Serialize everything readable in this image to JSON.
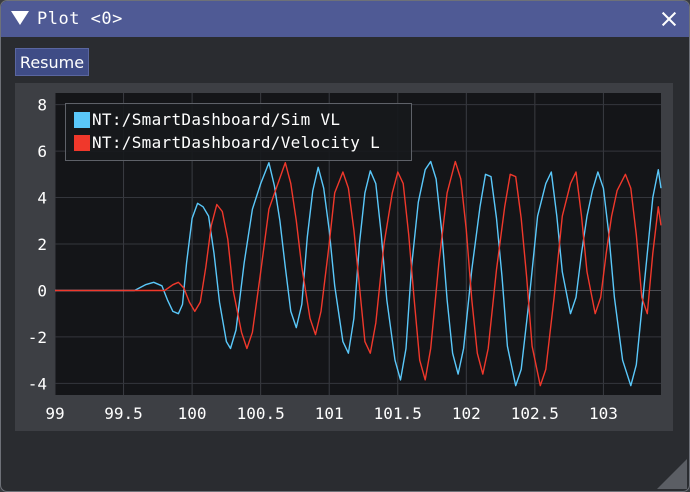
{
  "window": {
    "title": "Plot <0>"
  },
  "toolbar": {
    "resume_label": "Resume"
  },
  "colors": {
    "title_bar": "#4f5a95",
    "window_bg": "#2a2c30",
    "plot_bg": "#141518",
    "series_sim_vl": "#5ac8fa",
    "series_velocity_l": "#f0382b"
  },
  "icons": {
    "collapse": "triangle-down-icon",
    "close": "close-icon",
    "resize": "resize-grip-icon"
  },
  "chart_data": {
    "type": "line",
    "title": "",
    "xlabel": "",
    "ylabel": "",
    "xlim": [
      99,
      103.42
    ],
    "ylim": [
      -4.5,
      8.5
    ],
    "xticks": [
      "99",
      "99.5",
      "100",
      "100.5",
      "101",
      "101.5",
      "102",
      "102.5",
      "103"
    ],
    "yticks": [
      "8",
      "6",
      "4",
      "2",
      "0",
      "-2",
      "-4"
    ],
    "grid": true,
    "legend_placement": "top-left",
    "series": [
      {
        "name": "NT:/SmartDashboard/Sim VL",
        "color": "#5ac8fa",
        "points": [
          [
            99.0,
            0
          ],
          [
            99.58,
            0
          ],
          [
            99.66,
            0.25
          ],
          [
            99.72,
            0.35
          ],
          [
            99.78,
            0.2
          ],
          [
            99.82,
            -0.4
          ],
          [
            99.86,
            -0.9
          ],
          [
            99.9,
            -1.0
          ],
          [
            99.93,
            -0.6
          ],
          [
            99.96,
            1.2
          ],
          [
            100.0,
            3.1
          ],
          [
            100.04,
            3.75
          ],
          [
            100.08,
            3.6
          ],
          [
            100.12,
            3.2
          ],
          [
            100.16,
            1.6
          ],
          [
            100.2,
            -0.5
          ],
          [
            100.25,
            -2.2
          ],
          [
            100.28,
            -2.5
          ],
          [
            100.32,
            -1.7
          ],
          [
            100.38,
            1.2
          ],
          [
            100.44,
            3.5
          ],
          [
            100.5,
            4.6
          ],
          [
            100.56,
            5.5
          ],
          [
            100.6,
            4.5
          ],
          [
            100.64,
            3.0
          ],
          [
            100.68,
            1.0
          ],
          [
            100.72,
            -0.9
          ],
          [
            100.76,
            -1.6
          ],
          [
            100.8,
            -0.6
          ],
          [
            100.84,
            2.3
          ],
          [
            100.88,
            4.3
          ],
          [
            100.92,
            5.3
          ],
          [
            100.96,
            4.4
          ],
          [
            101.0,
            2.6
          ],
          [
            101.04,
            0.2
          ],
          [
            101.1,
            -2.2
          ],
          [
            101.14,
            -2.7
          ],
          [
            101.18,
            -1.2
          ],
          [
            101.22,
            2.0
          ],
          [
            101.26,
            4.2
          ],
          [
            101.3,
            5.15
          ],
          [
            101.34,
            4.6
          ],
          [
            101.38,
            2.4
          ],
          [
            101.42,
            -0.4
          ],
          [
            101.48,
            -3.0
          ],
          [
            101.52,
            -3.85
          ],
          [
            101.56,
            -2.5
          ],
          [
            101.6,
            1.0
          ],
          [
            101.65,
            3.8
          ],
          [
            101.7,
            5.2
          ],
          [
            101.74,
            5.55
          ],
          [
            101.78,
            4.8
          ],
          [
            101.82,
            2.6
          ],
          [
            101.86,
            -0.4
          ],
          [
            101.9,
            -2.7
          ],
          [
            101.94,
            -3.6
          ],
          [
            101.98,
            -2.5
          ],
          [
            102.04,
            0.9
          ],
          [
            102.1,
            3.6
          ],
          [
            102.14,
            5.0
          ],
          [
            102.18,
            4.9
          ],
          [
            102.22,
            3.1
          ],
          [
            102.26,
            0.6
          ],
          [
            102.3,
            -2.4
          ],
          [
            102.36,
            -4.1
          ],
          [
            102.4,
            -3.4
          ],
          [
            102.46,
            -0.3
          ],
          [
            102.52,
            3.2
          ],
          [
            102.58,
            4.6
          ],
          [
            102.62,
            5.1
          ],
          [
            102.66,
            3.2
          ],
          [
            102.7,
            0.8
          ],
          [
            102.76,
            -1.0
          ],
          [
            102.8,
            -0.3
          ],
          [
            102.84,
            1.6
          ],
          [
            102.88,
            3.2
          ],
          [
            102.92,
            4.3
          ],
          [
            102.96,
            5.1
          ],
          [
            103.0,
            4.4
          ],
          [
            103.04,
            2.4
          ],
          [
            103.08,
            -0.3
          ],
          [
            103.14,
            -3.0
          ],
          [
            103.2,
            -4.1
          ],
          [
            103.24,
            -3.2
          ],
          [
            103.28,
            -0.8
          ],
          [
            103.32,
            1.6
          ],
          [
            103.36,
            4.0
          ],
          [
            103.4,
            5.2
          ],
          [
            103.42,
            4.4
          ]
        ]
      },
      {
        "name": "NT:/SmartDashboard/Velocity L",
        "color": "#f0382b",
        "points": [
          [
            99.0,
            0
          ],
          [
            99.8,
            0
          ],
          [
            99.86,
            0.25
          ],
          [
            99.9,
            0.35
          ],
          [
            99.94,
            0.1
          ],
          [
            99.98,
            -0.5
          ],
          [
            100.02,
            -0.9
          ],
          [
            100.06,
            -0.5
          ],
          [
            100.1,
            1.0
          ],
          [
            100.14,
            2.8
          ],
          [
            100.18,
            3.7
          ],
          [
            100.22,
            3.4
          ],
          [
            100.26,
            2.2
          ],
          [
            100.3,
            0.0
          ],
          [
            100.36,
            -1.8
          ],
          [
            100.4,
            -2.5
          ],
          [
            100.44,
            -1.8
          ],
          [
            100.5,
            0.8
          ],
          [
            100.56,
            3.5
          ],
          [
            100.62,
            4.5
          ],
          [
            100.68,
            5.5
          ],
          [
            100.72,
            4.6
          ],
          [
            100.76,
            3.0
          ],
          [
            100.8,
            1.0
          ],
          [
            100.86,
            -1.2
          ],
          [
            100.9,
            -1.9
          ],
          [
            100.94,
            -0.9
          ],
          [
            101.0,
            2.0
          ],
          [
            101.04,
            4.2
          ],
          [
            101.1,
            5.1
          ],
          [
            101.14,
            4.4
          ],
          [
            101.18,
            2.6
          ],
          [
            101.22,
            0.2
          ],
          [
            101.26,
            -2.2
          ],
          [
            101.3,
            -2.7
          ],
          [
            101.34,
            -1.4
          ],
          [
            101.4,
            2.0
          ],
          [
            101.46,
            4.2
          ],
          [
            101.5,
            5.1
          ],
          [
            101.54,
            4.6
          ],
          [
            101.58,
            2.4
          ],
          [
            101.62,
            -0.4
          ],
          [
            101.66,
            -3.0
          ],
          [
            101.7,
            -3.85
          ],
          [
            101.74,
            -2.5
          ],
          [
            101.8,
            1.2
          ],
          [
            101.86,
            4.2
          ],
          [
            101.92,
            5.55
          ],
          [
            101.96,
            4.8
          ],
          [
            102.0,
            2.6
          ],
          [
            102.04,
            -0.4
          ],
          [
            102.08,
            -2.7
          ],
          [
            102.12,
            -3.6
          ],
          [
            102.16,
            -2.5
          ],
          [
            102.22,
            0.9
          ],
          [
            102.28,
            3.6
          ],
          [
            102.32,
            5.0
          ],
          [
            102.36,
            4.9
          ],
          [
            102.4,
            3.1
          ],
          [
            102.44,
            0.6
          ],
          [
            102.48,
            -2.4
          ],
          [
            102.54,
            -4.1
          ],
          [
            102.58,
            -3.4
          ],
          [
            102.64,
            -0.3
          ],
          [
            102.7,
            3.2
          ],
          [
            102.76,
            4.6
          ],
          [
            102.8,
            5.1
          ],
          [
            102.84,
            3.2
          ],
          [
            102.88,
            0.8
          ],
          [
            102.94,
            -1.0
          ],
          [
            102.98,
            -0.3
          ],
          [
            103.02,
            1.6
          ],
          [
            103.06,
            3.2
          ],
          [
            103.1,
            4.3
          ],
          [
            103.16,
            5.0
          ],
          [
            103.2,
            4.4
          ],
          [
            103.24,
            2.4
          ],
          [
            103.28,
            -0.3
          ],
          [
            103.32,
            -1.0
          ],
          [
            103.36,
            1.6
          ],
          [
            103.4,
            3.6
          ],
          [
            103.42,
            2.8
          ]
        ]
      }
    ]
  }
}
